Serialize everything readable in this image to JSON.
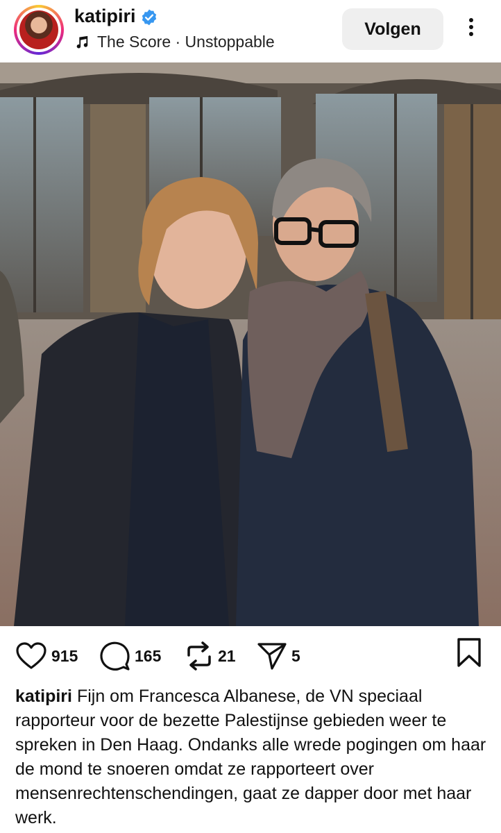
{
  "post": {
    "username": "katipiri",
    "music": "The Score · Unstoppable",
    "follow_label": "Volgen",
    "likes": "915",
    "comments": "165",
    "reposts": "21",
    "shares": "5",
    "caption_user": "katipiri",
    "caption_text": "Fijn om Francesca Albanese, de VN speciaal rapporteur voor de bezette Palestijnse gebieden weer te spreken in Den Haag. Ondanks alle wrede pogingen om haar de mond te snoeren omdat ze rapporteert over mensenrechtenschendingen, gaat ze dapper door met haar werk."
  },
  "icons": {
    "verified": "verified-badge-icon",
    "music": "music-note-icon",
    "more": "more-options-icon",
    "mute": "muted-speaker-icon",
    "like": "heart-icon",
    "comment": "comment-bubble-icon",
    "repost": "repost-icon",
    "share": "paper-plane-icon",
    "save": "bookmark-icon"
  },
  "colors": {
    "verified_blue": "#3797f0",
    "follow_bg": "#efefef",
    "text": "#111111"
  }
}
